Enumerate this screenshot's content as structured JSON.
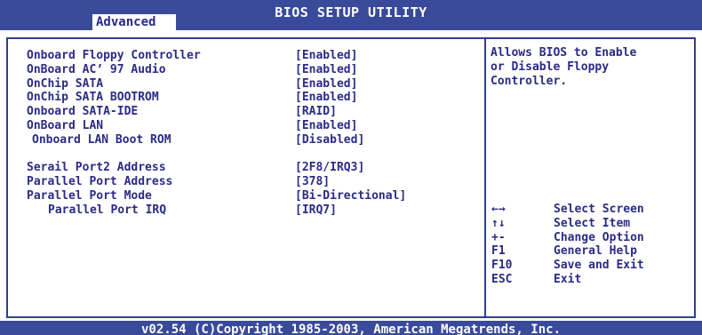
{
  "header": {
    "title": "BIOS SETUP UTILITY",
    "active_tab": "Advanced"
  },
  "settings": [
    {
      "label": "Onboard Floppy Controller",
      "value": "[Enabled]",
      "indent": 0
    },
    {
      "label": "OnBoard AC’ 97 Audio",
      "value": "[Enabled]",
      "indent": 0
    },
    {
      "label": "OnChip SATA",
      "value": "[Enabled]",
      "indent": 0
    },
    {
      "label": "OnChip SATA BOOTROM",
      "value": "[Enabled]",
      "indent": 0
    },
    {
      "label": "Onboard SATA-IDE",
      "value": "[RAID]",
      "indent": 0
    },
    {
      "label": "OnBoard LAN",
      "value": "[Enabled]",
      "indent": 0
    },
    {
      "label": "Onboard LAN Boot ROM",
      "value": "[Disabled]",
      "indent": 1
    },
    {
      "label": "Serail Port2 Address",
      "value": "[2F8/IRQ3]",
      "indent": 0
    },
    {
      "label": "Parallel Port Address",
      "value": "[378]",
      "indent": 0
    },
    {
      "label": "Parallel Port Mode",
      "value": "[Bi-Directional]",
      "indent": 0
    },
    {
      "label": "Parallel Port IRQ",
      "value": "[IRQ7]",
      "indent": 2
    }
  ],
  "help_text": "Allows BIOS to Enable\nor Disable Floppy\nController.",
  "keys": [
    {
      "key": "←→",
      "desc": "Select Screen",
      "icon": "left-right-arrows-icon"
    },
    {
      "key": "↑↓",
      "desc": "Select Item",
      "icon": "up-down-arrows-icon"
    },
    {
      "key": "+-",
      "desc": "Change Option",
      "icon": "plus-minus-icon"
    },
    {
      "key": "F1",
      "desc": "General Help",
      "icon": ""
    },
    {
      "key": "F10",
      "desc": "Save and Exit",
      "icon": ""
    },
    {
      "key": "ESC",
      "desc": "Exit",
      "icon": ""
    }
  ],
  "footer": "v02.54 (C)Copyright 1985-2003, American Megatrends, Inc.",
  "colors": {
    "bar": "#3a4a9a",
    "text": "#2a2b86",
    "frame": "#2f3f8f"
  }
}
